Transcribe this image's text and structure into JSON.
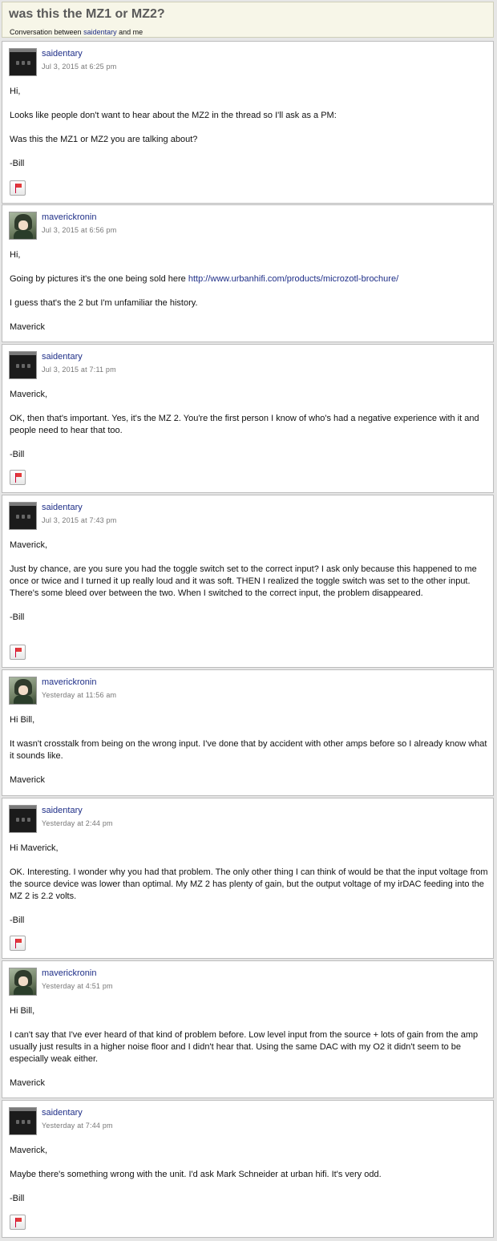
{
  "header": {
    "title": "was this the MZ1 or MZ2?",
    "sub_prefix": "Conversation between",
    "sub_user": "saidentary",
    "sub_suffix": "and me"
  },
  "messages": [
    {
      "author": "saidentary",
      "avatar": "dark",
      "date": "Jul 3, 2015 at 6:25 pm",
      "paragraphs": [
        "Hi,",
        "Looks like people don't want to hear about the MZ2 in the thread so I'll ask as a PM:",
        "Was this the MZ1 or MZ2 you are talking about?",
        "-Bill"
      ],
      "has_flag": true
    },
    {
      "author": "maverickronin",
      "avatar": "anime",
      "date": "Jul 3, 2015 at 6:56 pm",
      "paragraphs": [
        "Hi,",
        "Going by pictures it's the one being sold here",
        "I guess that's the 2 but I'm unfamiliar the history.",
        "Maverick"
      ],
      "link": "http://www.urbanhifi.com/products/microzotl-brochure/",
      "has_flag": false
    },
    {
      "author": "saidentary",
      "avatar": "dark",
      "date": "Jul 3, 2015 at 7:11 pm",
      "paragraphs": [
        "Maverick,",
        "OK, then that's important.  Yes, it's the MZ 2.  You're the first person I know of who's had a negative experience with it and people need to hear that too.",
        "-Bill"
      ],
      "has_flag": true
    },
    {
      "author": "saidentary",
      "avatar": "dark",
      "date": "Jul 3, 2015 at 7:43 pm",
      "paragraphs": [
        "Maverick,",
        "Just by chance, are you sure you had the toggle switch set to the correct input?  I ask only because this happened to me once or twice and I turned it up really loud and it was soft.  THEN I realized the toggle switch was set to the other input.  There's some bleed over between the two.  When I switched to the correct input, the problem disappeared.",
        "-Bill"
      ],
      "has_flag": true
    },
    {
      "author": "maverickronin",
      "avatar": "anime",
      "date": "Yesterday at 11:56 am",
      "paragraphs": [
        "Hi Bill,",
        "It wasn't crosstalk from being on the wrong input.  I've done that by accident with other amps before so I already know what it sounds like.",
        "Maverick"
      ],
      "has_flag": false
    },
    {
      "author": "saidentary",
      "avatar": "dark",
      "date": "Yesterday at 2:44 pm",
      "paragraphs": [
        "Hi Maverick,",
        "OK.  Interesting.  I wonder why you had that problem.  The only other thing I can think of would be that the input voltage from the source device was lower than optimal.  My MZ 2 has plenty of gain, but the output voltage of my irDAC feeding into the MZ 2 is 2.2 volts.",
        "-Bill"
      ],
      "has_flag": true
    },
    {
      "author": "maverickronin",
      "avatar": "anime",
      "date": "Yesterday at 4:51 pm",
      "paragraphs": [
        "Hi Bill,",
        "I can't say that I've ever heard of that kind of problem before.  Low level input from the source + lots of gain from the amp usually just results in a higher noise floor and I didn't hear that.  Using the same DAC with my O2 it didn't seem to be especially weak either.",
        "Maverick"
      ],
      "has_flag": false
    },
    {
      "author": "saidentary",
      "avatar": "dark",
      "date": "Yesterday at 7:44 pm",
      "paragraphs": [
        "Maverick,",
        "Maybe there's something wrong with the unit.  I'd ask Mark Schneider at urban hifi.  It's very odd.",
        "-Bill"
      ],
      "has_flag": true
    }
  ]
}
